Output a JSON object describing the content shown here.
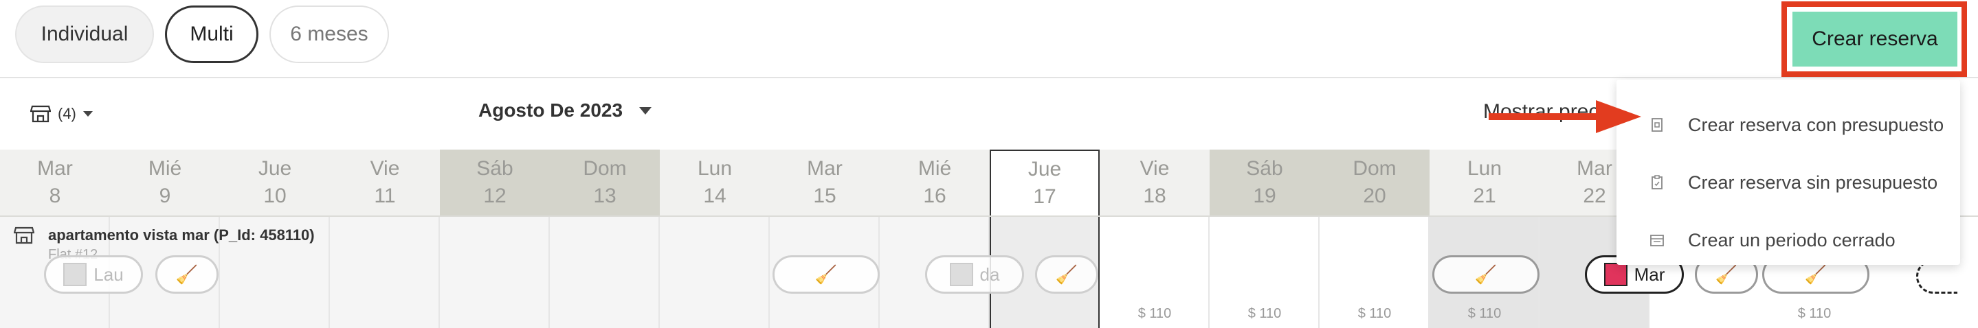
{
  "toolbar": {
    "view_modes": [
      "Individual",
      "Multi",
      "6 meses"
    ],
    "create_button_label": "Crear reserva"
  },
  "filters": {
    "property_count": "(4)",
    "month_label": "Agosto De 2023",
    "show_prices_label": "Mostrar prec"
  },
  "calendar": {
    "days": [
      {
        "weekday": "Mar",
        "day": "8"
      },
      {
        "weekday": "Mié",
        "day": "9"
      },
      {
        "weekday": "Jue",
        "day": "10"
      },
      {
        "weekday": "Vie",
        "day": "11"
      },
      {
        "weekday": "Sáb",
        "day": "12"
      },
      {
        "weekday": "Dom",
        "day": "13"
      },
      {
        "weekday": "Lun",
        "day": "14"
      },
      {
        "weekday": "Mar",
        "day": "15"
      },
      {
        "weekday": "Mié",
        "day": "16"
      },
      {
        "weekday": "Jue",
        "day": "17"
      },
      {
        "weekday": "Vie",
        "day": "18"
      },
      {
        "weekday": "Sáb",
        "day": "19"
      },
      {
        "weekday": "Dom",
        "day": "20"
      },
      {
        "weekday": "Lun",
        "day": "21"
      },
      {
        "weekday": "Mar",
        "day": "22"
      }
    ],
    "property": {
      "name": "apartamento vista mar (P_Id: 458110)",
      "subtitle": "Flat #12"
    },
    "bookings": {
      "lau": "Lau",
      "da": "da",
      "mar": "Mar"
    },
    "prices": [
      "$ 110",
      "$ 110",
      "$ 110",
      "$ 110",
      "$ 110"
    ]
  },
  "dropdown": {
    "items": [
      "Crear reserva con presupuesto",
      "Crear reserva sin presupuesto",
      "Crear un periodo cerrado"
    ]
  },
  "colors": {
    "accent_green": "#7ddcb7",
    "highlight_red": "#e23c1f",
    "weekend_header": "#d4d4cb",
    "booking_red": "#e0345c"
  }
}
